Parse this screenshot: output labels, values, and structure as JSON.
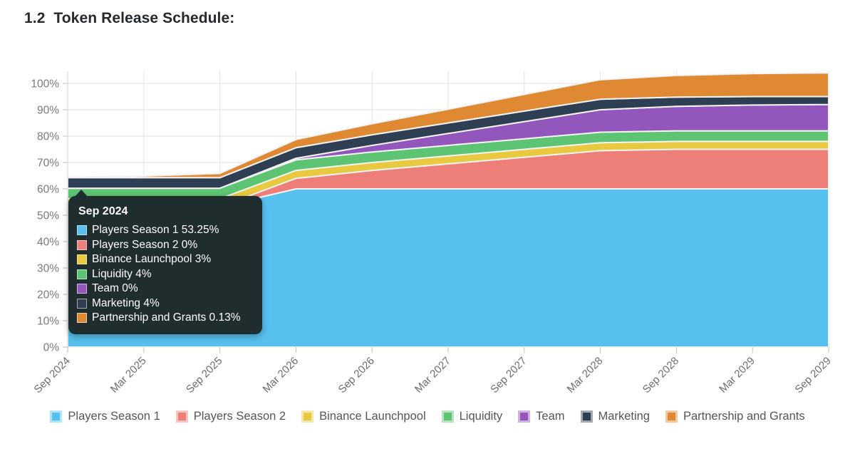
{
  "page_title": "1.2  Token Release Schedule:",
  "tooltip": {
    "title": "Sep 2024",
    "rows": [
      {
        "label": "Players Season 1 53.25%",
        "color": "#56c0ee"
      },
      {
        "label": "Players Season 2 0%",
        "color": "#ee7f78"
      },
      {
        "label": "Binance Launchpool 3%",
        "color": "#e8c93f"
      },
      {
        "label": "Liquidity 4%",
        "color": "#5cc473"
      },
      {
        "label": "Team 0%",
        "color": "#9256bd"
      },
      {
        "label": "Marketing 4%",
        "color": "#2f3f53"
      },
      {
        "label": "Partnership and Grants 0.13%",
        "color": "#df8933"
      }
    ]
  },
  "legend": {
    "items": [
      {
        "label": "Players Season 1",
        "color": "#56c0ee"
      },
      {
        "label": "Players Season 2",
        "color": "#ee7f78"
      },
      {
        "label": "Binance Launchpool",
        "color": "#e8c93f"
      },
      {
        "label": "Liquidity",
        "color": "#5cc473"
      },
      {
        "label": "Team",
        "color": "#9256bd"
      },
      {
        "label": "Marketing",
        "color": "#2f3f53"
      },
      {
        "label": "Partnership and Grants",
        "color": "#df8933"
      }
    ]
  },
  "chart_data": {
    "type": "area",
    "stacked": true,
    "title": "Token Release Schedule",
    "xlabel": "",
    "ylabel": "",
    "ylim": [
      0,
      100
    ],
    "yticks": [
      0,
      10,
      20,
      30,
      40,
      50,
      60,
      70,
      80,
      90,
      100
    ],
    "ytick_labels": [
      "0%",
      "10%",
      "20%",
      "30%",
      "40%",
      "50%",
      "60%",
      "70%",
      "80%",
      "90%",
      "100%"
    ],
    "grid": true,
    "legend_position": "bottom",
    "categories": [
      "Sep 2024",
      "Mar 2025",
      "Sep 2025",
      "Mar 2026",
      "Sep 2026",
      "Mar 2027",
      "Sep 2027",
      "Mar 2028",
      "Sep 2028",
      "Mar 2029",
      "Sep 2029"
    ],
    "x_tick_labels": [
      "Sep 2024",
      "Mar 2025",
      "Sep 2025",
      "Mar 2026",
      "Sep 2026",
      "Mar 2027",
      "Sep 2027",
      "Mar 2028",
      "Sep 2028",
      "Mar 2029",
      "Sep 2029"
    ],
    "series": [
      {
        "name": "Players Season 1",
        "color": "#56c0ee",
        "values": [
          53.25,
          53.25,
          53.25,
          60,
          60,
          60,
          60,
          60,
          60,
          60,
          60
        ]
      },
      {
        "name": "Players Season 2",
        "color": "#ee7f78",
        "values": [
          0,
          0,
          0,
          4,
          7,
          9.5,
          12,
          14.5,
          15,
          15,
          15
        ]
      },
      {
        "name": "Binance Launchpool",
        "color": "#e8c93f",
        "values": [
          3,
          3,
          3,
          3,
          3,
          3,
          3,
          3,
          3,
          3,
          3
        ]
      },
      {
        "name": "Liquidity",
        "color": "#5cc473",
        "values": [
          4,
          4,
          4,
          4,
          4,
          4,
          4,
          4,
          4,
          4,
          4
        ]
      },
      {
        "name": "Team",
        "color": "#9256bd",
        "values": [
          0,
          0,
          0,
          0.6,
          2.5,
          4.5,
          6.5,
          8.5,
          9.3,
          9.8,
          10
        ]
      },
      {
        "name": "Marketing",
        "color": "#2f3f53",
        "values": [
          4,
          4,
          4,
          4,
          4,
          4,
          4,
          4,
          3.5,
          3.2,
          3
        ]
      },
      {
        "name": "Partnership and Grants",
        "color": "#df8933",
        "values": [
          0.13,
          0.6,
          1.6,
          3.1,
          4.2,
          5.2,
          6.3,
          7.4,
          8.2,
          8.7,
          9
        ]
      }
    ],
    "totals": [
      64.38,
      64.85,
      65.85,
      74.7,
      80.7,
      86.2,
      91.8,
      97.4,
      99,
      99.7,
      100
    ]
  }
}
